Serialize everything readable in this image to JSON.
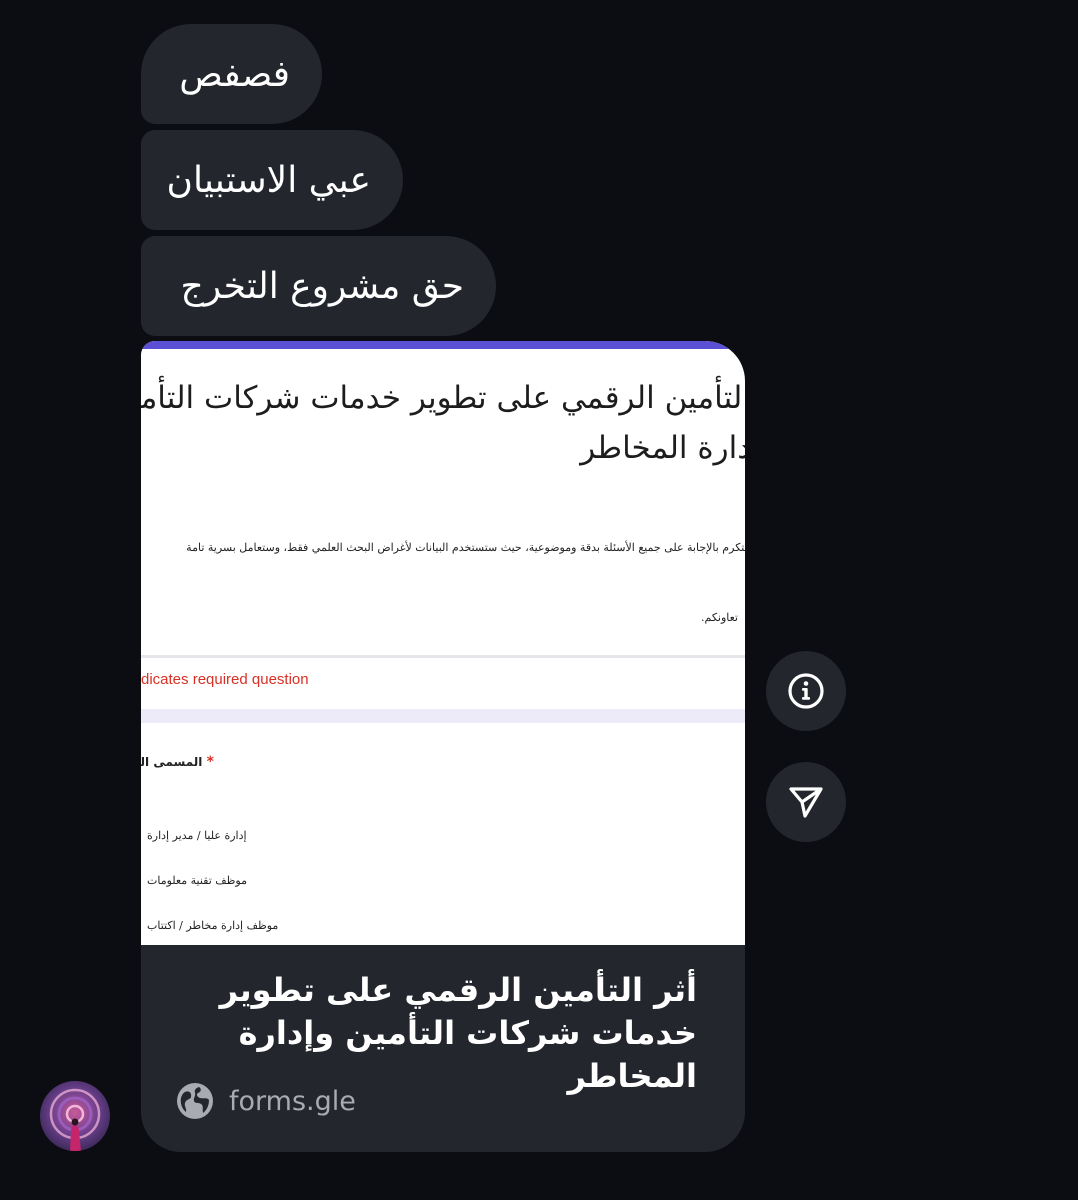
{
  "messages": [
    {
      "text": "فصفص"
    },
    {
      "text": "عبي الاستبيان"
    },
    {
      "text": "حق مشروع التخرج"
    }
  ],
  "link_card": {
    "preview": {
      "title_line1": "التأمين الرقمي على تطوير خدمات شركات التأمين",
      "title_line2": "دارة المخاطر",
      "description_line1": "التكرم بالإجابة على جميع الأسئلة بدقة وموضوعية، حيث ستستخدم البيانات لأغراض البحث العلمي فقط، وستعامل بسرية تامة",
      "description_line2": "تعاونكم.",
      "required_note": "dicates required question",
      "question_label": "المسمى الو",
      "required_star": "*",
      "options": [
        "إدارة عليا / مدير إدارة",
        "موظف تقنية معلومات",
        "موظف إدارة مخاطر / اكتتاب"
      ],
      "accent_color": "#5b4fd6"
    },
    "title": "أثر التأمين الرقمي على تطوير خدمات شركات التأمين وإدارة المخاطر",
    "domain": "forms.gle",
    "domain_icon": "globe-icon"
  },
  "actions": {
    "info_icon": "info-icon",
    "share_icon": "send-icon"
  },
  "colors": {
    "background": "#0b0d12",
    "bubble": "#23262c",
    "text": "#ffffff",
    "link_muted": "#a8abb0"
  }
}
